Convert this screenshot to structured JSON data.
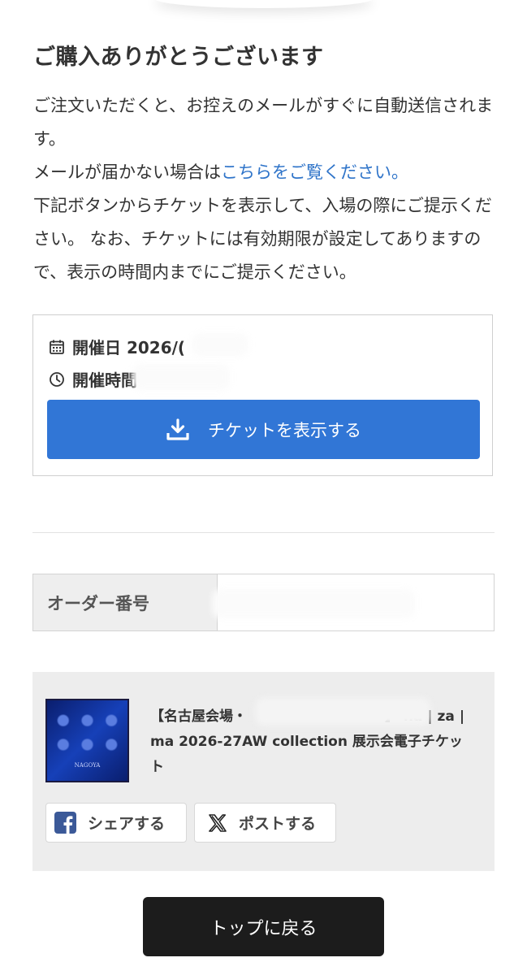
{
  "header": {
    "title": "ご購入ありがとうございます"
  },
  "message": {
    "line1": "ご注文いただくと、お控えのメールがすぐに自動送信されます。",
    "line2_prefix": "メールが届かない場合は",
    "line2_link": "こちらをご覧ください。",
    "line3": "下記ボタンからチケットを表示して、入場の際にご提示ください。 なお、チケットには有効期限が設定してありますので、表示の時間内までにご提示ください。"
  },
  "event": {
    "date_label": "開催日 2026/(",
    "time_label": "開催時間",
    "ticket_button_label": "チケットを表示する"
  },
  "order": {
    "label": "オーダー番号",
    "value": ""
  },
  "product": {
    "title": "【名古屋会場・　　　　　　　　　　】 ha | za | ma 2026-27AW collection 展示会電子チケット",
    "thumbnail_text": "NAGOYA",
    "share_facebook_label": "シェアする",
    "share_x_label": "ポストする"
  },
  "footer": {
    "back_button_label": "トップに戻る"
  },
  "colors": {
    "link": "#2f74c9",
    "primary_button": "#3176d6",
    "back_button": "#1c1c1c",
    "facebook": "#3b5998"
  }
}
